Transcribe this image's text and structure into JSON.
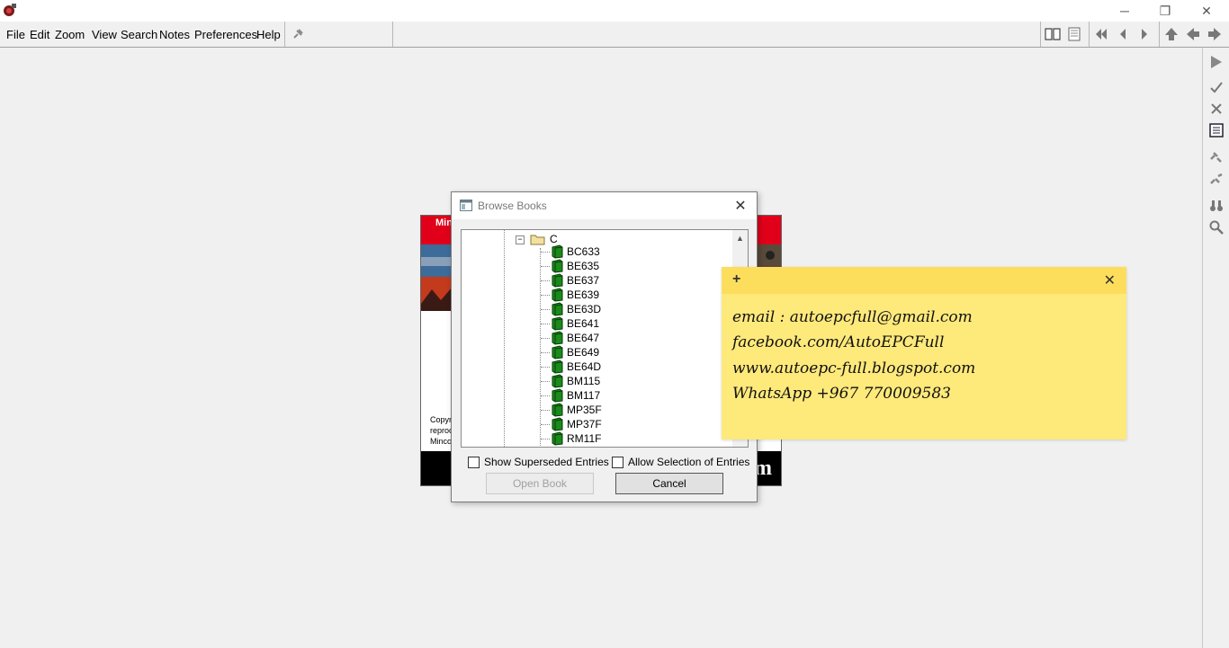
{
  "window": {
    "controls": {
      "minimize": "─",
      "restore": "❐",
      "close": "✕"
    }
  },
  "menu": [
    "File",
    "Edit",
    "Zoom",
    "View",
    "Search",
    "Notes",
    "Preferences",
    "Help"
  ],
  "toolbar_icons": [
    "pin-icon",
    "book-open-icon",
    "books-icon",
    "first-page-icon",
    "prev-page-icon",
    "next-page-icon",
    "up-icon",
    "back-icon",
    "forward-icon"
  ],
  "right_toolbar_icons": [
    "play-icon",
    "check-icon",
    "x-icon",
    "list-icon",
    "link-icon",
    "unlink-icon",
    "binoculars-icon",
    "search-zoom-icon"
  ],
  "background_cover": {
    "title": "Min",
    "copy_lines": [
      "Copyr",
      "reproc",
      "Minco"
    ],
    "tail_text": "m"
  },
  "dialog": {
    "title": "Browse Books",
    "close": "✕",
    "folder": {
      "expander": "−",
      "label": "C"
    },
    "books": [
      "BC633",
      "BE635",
      "BE637",
      "BE639",
      "BE63D",
      "BE641",
      "BE647",
      "BE649",
      "BE64D",
      "BM115",
      "BM117",
      "MP35F",
      "MP37F",
      "RM11F"
    ],
    "scroll_up": "▲",
    "show_superseded": "Show Superseded Entries",
    "allow_selection": "Allow Selection of Entries",
    "open_button": "Open Book",
    "cancel_button": "Cancel"
  },
  "sticky_note": {
    "add": "+",
    "close": "✕",
    "lines": [
      "email : autoepcfull@gmail.com",
      "facebook.com/AutoEPCFull",
      "www.autoepc-full.blogspot.com",
      "WhatsApp +967 770009583"
    ]
  },
  "colors": {
    "sticky_body": "#fee97b",
    "sticky_header": "#fdde5c",
    "cover_red": "#e1001a",
    "book_green": "#1a8a1a"
  }
}
